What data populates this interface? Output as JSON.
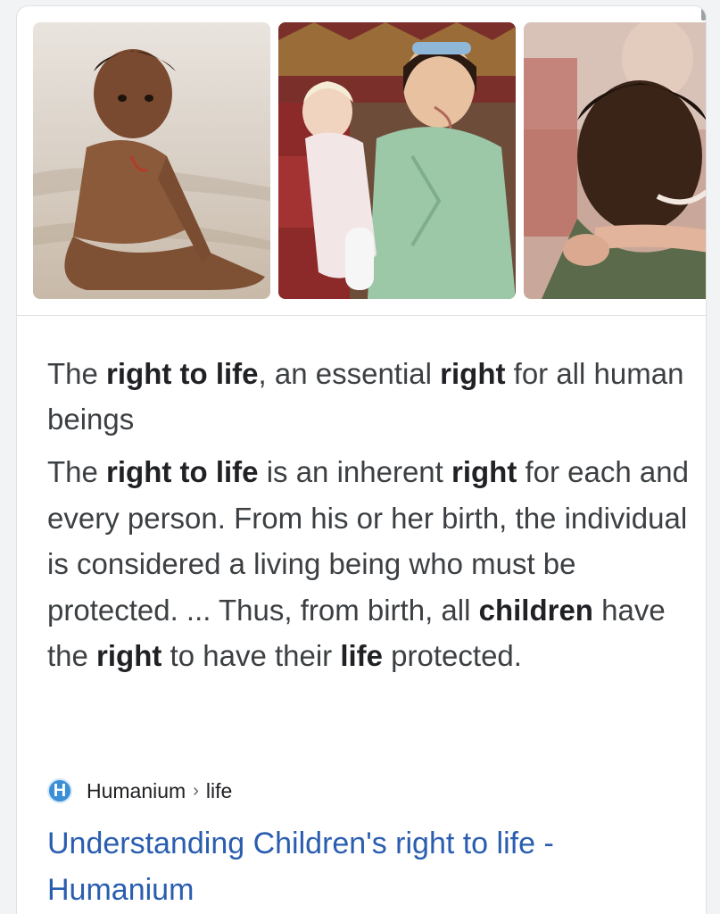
{
  "images": [
    {
      "alt": "child sitting on beach",
      "icon": "photo-child-beach"
    },
    {
      "alt": "woman holding baby",
      "icon": "photo-mother-baby"
    },
    {
      "alt": "man hugging child",
      "icon": "photo-man-hug"
    }
  ],
  "featured": {
    "title_parts": [
      {
        "text": "The ",
        "bold": false
      },
      {
        "text": "right to life",
        "bold": true
      },
      {
        "text": ", an essential ",
        "bold": false
      },
      {
        "text": "right",
        "bold": true
      },
      {
        "text": " for all human beings",
        "bold": false
      }
    ],
    "snippet_parts": [
      {
        "text": "The ",
        "bold": false
      },
      {
        "text": "right to life",
        "bold": true
      },
      {
        "text": " is an inherent ",
        "bold": false
      },
      {
        "text": "right",
        "bold": true
      },
      {
        "text": " for each and every person. From his or her birth, the individual is considered a living being who must be protected. ... Thus, from birth, all ",
        "bold": false
      },
      {
        "text": "children",
        "bold": true
      },
      {
        "text": " have the ",
        "bold": false
      },
      {
        "text": "right",
        "bold": true
      },
      {
        "text": " to have their ",
        "bold": false
      },
      {
        "text": "life",
        "bold": true
      },
      {
        "text": " protected.",
        "bold": false
      }
    ]
  },
  "source": {
    "favicon_letter": "H",
    "name": "Humanium",
    "separator": "›",
    "path": "life"
  },
  "result": {
    "link_text": "Understanding Children's right to life - Humanium"
  },
  "colors": {
    "link": "#2a5db0",
    "favicon": "#3b8fd6"
  }
}
